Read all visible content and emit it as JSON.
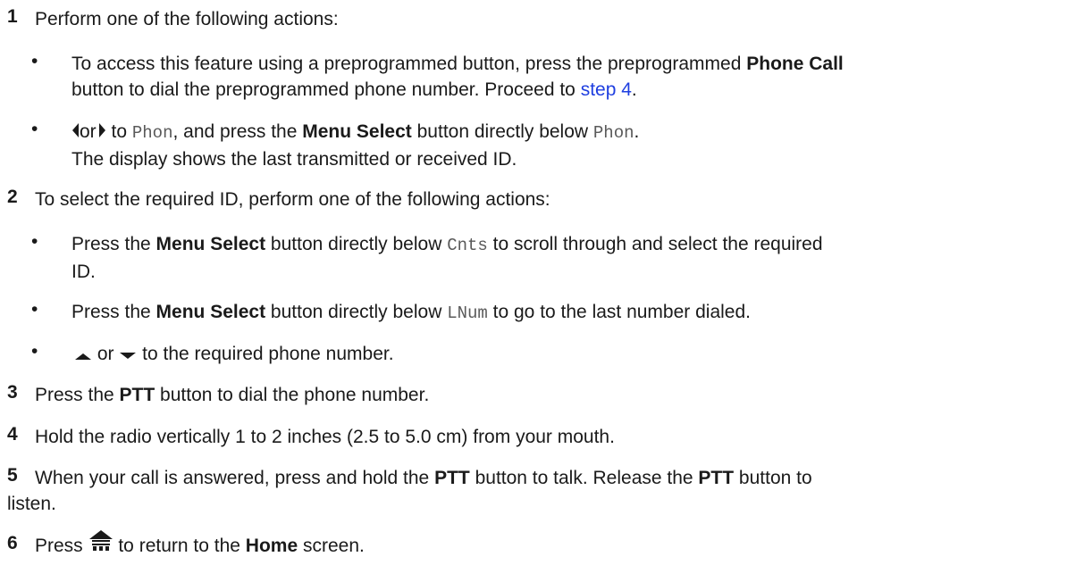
{
  "steps": [
    {
      "num": "1",
      "text": "Perform one of the following actions:"
    },
    {
      "num": "2",
      "text": "To select the required ID, perform one of the following actions:"
    },
    {
      "num": "3",
      "pre": "Press the ",
      "bold": "PTT",
      "post": " button to dial the phone number."
    },
    {
      "num": "4",
      "text": "Hold the radio vertically 1 to 2 inches (2.5 to 5.0 cm) from your mouth."
    },
    {
      "num": "5",
      "pre": "When your call is answered, press and hold the ",
      "bold1": "PTT",
      "mid": " button to talk. Release the ",
      "bold2": "PTT",
      "post_line1": " button to",
      "line2": "listen."
    },
    {
      "num": "6",
      "pre": "Press ",
      "mid": " to return to the ",
      "bold": "Home",
      "post": " screen."
    }
  ],
  "step1_bullets": {
    "b1": {
      "pre": "To access this feature using a preprogrammed button, press the preprogrammed ",
      "bold": "Phone Call",
      "line2_pre": "button to dial the preprogrammed phone number. Proceed to ",
      "link": "step 4",
      "line2_post": "."
    },
    "b2": {
      "or": "or",
      "to": " to ",
      "code1": "Phon",
      "mid": ", and press the ",
      "bold": "Menu Select",
      "mid2": " button directly below ",
      "code2": "Phon",
      "end": ".",
      "line2": "The display shows the last transmitted or received ID."
    }
  },
  "step2_bullets": {
    "b1": {
      "pre": "Press the ",
      "bold": "Menu Select",
      "mid": " button directly below ",
      "code": "Cnts",
      "post": " to scroll through and select the required",
      "line2": "ID."
    },
    "b2": {
      "pre": "Press the ",
      "bold": "Menu Select",
      "mid": " button directly below ",
      "code": "LNum",
      "post": " to go to the last number dialed."
    },
    "b3": {
      "or": " or ",
      "post": " to the required phone number."
    }
  },
  "bullet_char": "•",
  "icons": {
    "left": "left-arrow-icon",
    "right": "right-arrow-icon",
    "up": "up-arrow-icon",
    "down": "down-arrow-icon",
    "home": "home-icon"
  },
  "colors": {
    "link": "#1f3fe0",
    "code": "#5a5a5a",
    "text": "#1a1a1a"
  }
}
